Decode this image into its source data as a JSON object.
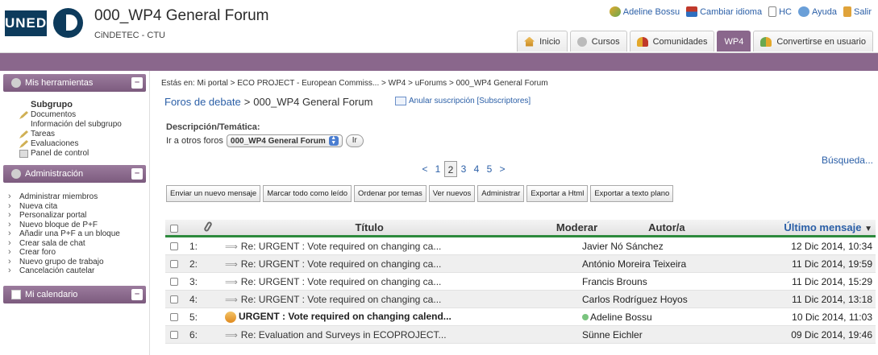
{
  "header": {
    "logo_text": "UNED",
    "site_title": "000_WP4 General Forum",
    "site_subtitle": "CiNDETEC - CTU",
    "user_links": [
      {
        "label": "Adeline Bossu",
        "icon": "users-icon"
      },
      {
        "label": "Cambiar idioma",
        "icon": "flag-icon"
      },
      {
        "label": "HC",
        "icon": "document-icon"
      },
      {
        "label": "Ayuda",
        "icon": "help-icon"
      },
      {
        "label": "Salir",
        "icon": "exit-icon"
      }
    ],
    "tabs": [
      {
        "label": "Inicio",
        "icon": "home-icon"
      },
      {
        "label": "Cursos",
        "icon": "courses-icon"
      },
      {
        "label": "Comunidades",
        "icon": "communities-icon"
      },
      {
        "label": "WP4",
        "icon": ""
      },
      {
        "label": "Convertirse en usuario",
        "icon": "become-user-icon"
      }
    ]
  },
  "sidebar": {
    "tools_title": "Mis herramientas",
    "subgroup_title": "Subgrupo",
    "subgroup_items": [
      "Documentos",
      "Información del subgrupo",
      "Tareas",
      "Evaluaciones",
      "Panel de control"
    ],
    "admin_title": "Administración",
    "admin_items": [
      "Administrar miembros",
      "Nueva cita",
      "Personalizar portal",
      "Nuevo bloque de P+F",
      "Añadir una P+F a un bloque",
      "Crear sala de chat",
      "Crear foro",
      "Nuevo grupo de trabajo",
      "Cancelación cautelar"
    ],
    "calendar_title": "Mi calendario"
  },
  "main": {
    "breadcrumb_prefix": "Estás en:",
    "breadcrumb": [
      "Mi portal",
      "ECO PROJECT - European Commiss...",
      "WP4",
      "uForums",
      "000_WP4 General Forum"
    ],
    "breadcrumb_sep": ">",
    "nav_link": "Foros de debate",
    "nav_current": "000_WP4 General Forum",
    "unsubscribe": "Anular suscripción [Subscriptores]",
    "desc_label": "Descripción/Temática:",
    "goto_label": "Ir a otros foros",
    "goto_selected": "000_WP4 General Forum",
    "goto_button": "Ir",
    "search": "Búsqueda...",
    "pager": {
      "prev": "<",
      "next": ">",
      "pages": [
        "1",
        "2",
        "3",
        "4",
        "5"
      ],
      "current": "2"
    },
    "actions": [
      "Enviar un nuevo mensaje",
      "Marcar todo como leído",
      "Ordenar por temas",
      "Ver nuevos",
      "Administrar",
      "Exportar a Html",
      "Exportar a texto plano"
    ]
  },
  "table": {
    "headers": {
      "title": "Título",
      "moderate": "Moderar",
      "author": "Autor/a",
      "last": "Último mensaje"
    },
    "rows": [
      {
        "num": "1:",
        "title": "Re: URGENT : Vote required on changing ca...",
        "author": "Javier Nó Sánchez",
        "last": "12 Dic 2014, 10:34",
        "reply": true,
        "bold": false,
        "online": false
      },
      {
        "num": "2:",
        "title": "Re: URGENT : Vote required on changing ca...",
        "author": "António Moreira Teixeira",
        "last": "11 Dic 2014, 19:59",
        "reply": true,
        "bold": false,
        "online": false
      },
      {
        "num": "3:",
        "title": "Re: URGENT : Vote required on changing ca...",
        "author": "Francis Brouns",
        "last": "11 Dic 2014, 15:29",
        "reply": true,
        "bold": false,
        "online": false
      },
      {
        "num": "4:",
        "title": "Re: URGENT : Vote required on changing ca...",
        "author": "Carlos Rodríguez Hoyos",
        "last": "11 Dic 2014, 13:18",
        "reply": true,
        "bold": false,
        "online": false
      },
      {
        "num": "5:",
        "title": "URGENT : Vote required on changing calend...",
        "author": "Adeline Bossu",
        "last": "10 Dic 2014, 11:03",
        "reply": false,
        "bold": true,
        "online": true
      },
      {
        "num": "6:",
        "title": "Re: Evaluation and Surveys in ECOPROJECT...",
        "author": "Sünne Eichler",
        "last": "09 Dic 2014, 19:46",
        "reply": true,
        "bold": false,
        "online": false
      }
    ]
  },
  "colors": {
    "accent": "#8a678c",
    "link": "#2b5fa7",
    "green_rule": "#2d8a3d",
    "brand": "#0d3b5c"
  }
}
